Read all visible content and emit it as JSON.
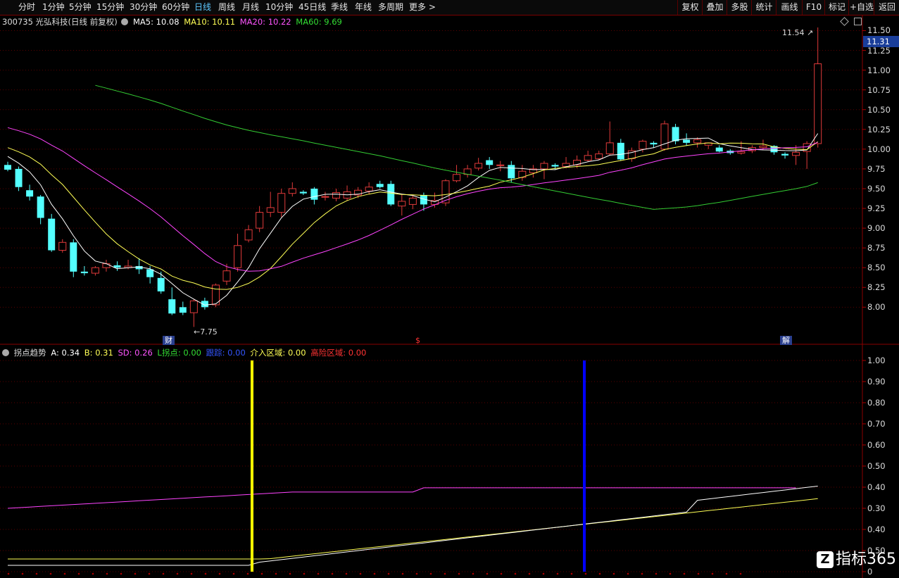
{
  "toolbar": {
    "periods": [
      "分时",
      "1分钟",
      "5分钟",
      "15分钟",
      "30分钟",
      "60分钟",
      "日线",
      "周线",
      "月线",
      "10分钟",
      "45日线",
      "季线",
      "年线",
      "多周期",
      "更多 >"
    ],
    "active_period": "日线",
    "right_buttons": [
      "复权",
      "叠加",
      "多股",
      "统计",
      "画线",
      "F10",
      "标记",
      "+自选",
      "返回"
    ]
  },
  "stock": {
    "code_name": "300735 光弘科技(日线 前复权)",
    "ma5_label": "MA5: 10.08",
    "ma10_label": "MA10: 10.11",
    "ma20_label": "MA20: 10.22",
    "ma60_label": "MA60: 9.69",
    "current_price": "11.31",
    "high_marker": "11.54",
    "low_marker": "7.75",
    "bottom_markers": [
      "财",
      "$",
      "解"
    ]
  },
  "indicator": {
    "name": "拐点趋势",
    "a_label": "A: 0.34",
    "b_label": "B: 0.31",
    "sd_label": "SD: 0.26",
    "l_label": "L拐点: 0.00",
    "track_label": "跟踪: 0.00",
    "entry_label": "介入区域: 0.00",
    "risk_label": "高险区域: 0.00",
    "y_ticks": [
      "1.00",
      "0.90",
      "0.80",
      "0.70",
      "0.60",
      "0.50",
      "0.40",
      "0.30",
      "0.40",
      "0.50",
      "0"
    ]
  },
  "colors": {
    "up": "#e03a3a",
    "down": "#54ffff",
    "ma5": "#ffffff",
    "ma10": "#ffff55",
    "ma20": "#ff44ff",
    "ma60": "#33cc33",
    "yellow_signal": "#ffff00",
    "blue_signal": "#0000ff"
  },
  "chart_data": {
    "type": "candlestick",
    "y_ticks": [
      11.5,
      11.25,
      11.0,
      10.75,
      10.5,
      10.25,
      10.0,
      9.75,
      9.5,
      9.25,
      9.0,
      8.75,
      8.5,
      8.25,
      8.0
    ],
    "ylim": [
      7.7,
      11.62
    ],
    "candles": [
      [
        9.8,
        9.74,
        9.84,
        9.72
      ],
      [
        9.75,
        9.52,
        9.78,
        9.47
      ],
      [
        9.48,
        9.4,
        9.55,
        9.35
      ],
      [
        9.4,
        9.13,
        9.42,
        9.05
      ],
      [
        9.12,
        8.72,
        9.18,
        8.7
      ],
      [
        8.72,
        8.82,
        8.86,
        8.69
      ],
      [
        8.82,
        8.45,
        8.86,
        8.38
      ],
      [
        8.45,
        8.43,
        8.52,
        8.4
      ],
      [
        8.43,
        8.5,
        8.52,
        8.4
      ],
      [
        8.5,
        8.55,
        8.6,
        8.45
      ],
      [
        8.53,
        8.5,
        8.58,
        8.46
      ],
      [
        8.5,
        8.52,
        8.6,
        8.48
      ],
      [
        8.52,
        8.48,
        8.62,
        8.42
      ],
      [
        8.48,
        8.38,
        8.52,
        8.3
      ],
      [
        8.37,
        8.2,
        8.45,
        8.17
      ],
      [
        8.1,
        7.92,
        8.25,
        7.9
      ],
      [
        8.0,
        7.93,
        8.07,
        7.9
      ],
      [
        7.93,
        8.08,
        8.1,
        7.75
      ],
      [
        8.08,
        8.0,
        8.12,
        7.97
      ],
      [
        8.03,
        8.28,
        8.3,
        8.0
      ],
      [
        8.33,
        8.46,
        8.55,
        8.28
      ],
      [
        8.5,
        8.78,
        8.93,
        8.45
      ],
      [
        8.85,
        8.98,
        9.04,
        8.82
      ],
      [
        9.0,
        9.2,
        9.28,
        8.95
      ],
      [
        9.2,
        9.26,
        9.46,
        9.14
      ],
      [
        9.2,
        9.44,
        9.5,
        9.14
      ],
      [
        9.44,
        9.5,
        9.58,
        9.4
      ],
      [
        9.46,
        9.44,
        9.48,
        9.42
      ],
      [
        9.5,
        9.36,
        9.52,
        9.3
      ],
      [
        9.4,
        9.4,
        9.46,
        9.35
      ],
      [
        9.38,
        9.45,
        9.5,
        9.34
      ],
      [
        9.38,
        9.46,
        9.54,
        9.35
      ],
      [
        9.42,
        9.48,
        9.52,
        9.38
      ],
      [
        9.47,
        9.52,
        9.58,
        9.43
      ],
      [
        9.56,
        9.52,
        9.6,
        9.5
      ],
      [
        9.56,
        9.3,
        9.6,
        9.28
      ],
      [
        9.28,
        9.34,
        9.42,
        9.16
      ],
      [
        9.3,
        9.38,
        9.42,
        9.24
      ],
      [
        9.42,
        9.3,
        9.45,
        9.22
      ],
      [
        9.3,
        9.35,
        9.45,
        9.26
      ],
      [
        9.32,
        9.6,
        9.62,
        9.28
      ],
      [
        9.6,
        9.68,
        9.8,
        9.58
      ],
      [
        9.68,
        9.75,
        9.8,
        9.64
      ],
      [
        9.76,
        9.82,
        9.89,
        9.73
      ],
      [
        9.86,
        9.8,
        9.9,
        9.75
      ],
      [
        9.8,
        9.8,
        9.85,
        9.72
      ],
      [
        9.8,
        9.63,
        9.85,
        9.58
      ],
      [
        9.64,
        9.72,
        9.8,
        9.6
      ],
      [
        9.7,
        9.75,
        9.8,
        9.64
      ],
      [
        9.75,
        9.82,
        9.85,
        9.62
      ],
      [
        9.8,
        9.78,
        9.82,
        9.74
      ],
      [
        9.78,
        9.82,
        9.9,
        9.76
      ],
      [
        9.8,
        9.86,
        9.92,
        9.76
      ],
      [
        9.86,
        9.92,
        9.98,
        9.84
      ],
      [
        9.88,
        9.94,
        9.98,
        9.86
      ],
      [
        9.94,
        10.08,
        10.35,
        9.92
      ],
      [
        10.08,
        9.87,
        10.13,
        9.85
      ],
      [
        9.88,
        9.98,
        10.02,
        9.84
      ],
      [
        10.0,
        10.1,
        10.12,
        9.96
      ],
      [
        10.08,
        10.06,
        10.1,
        10.02
      ],
      [
        10.0,
        10.32,
        10.36,
        9.98
      ],
      [
        10.28,
        10.1,
        10.32,
        10.06
      ],
      [
        10.12,
        10.08,
        10.2,
        10.04
      ],
      [
        10.08,
        10.12,
        10.15,
        10.02
      ],
      [
        10.05,
        10.08,
        10.08,
        10.0
      ],
      [
        10.02,
        9.97,
        10.05,
        9.96
      ],
      [
        9.98,
        9.95,
        10.0,
        9.93
      ],
      [
        9.95,
        9.97,
        10.1,
        9.93
      ],
      [
        9.98,
        10.02,
        10.05,
        9.95
      ],
      [
        10.02,
        10.04,
        10.12,
        9.99
      ],
      [
        10.04,
        9.96,
        10.05,
        9.93
      ],
      [
        9.94,
        9.92,
        9.96,
        9.88
      ],
      [
        9.92,
        9.96,
        10.05,
        9.8
      ],
      [
        9.97,
        10.07,
        10.1,
        9.75
      ],
      [
        10.07,
        11.08,
        11.54,
        10.02
      ]
    ]
  }
}
